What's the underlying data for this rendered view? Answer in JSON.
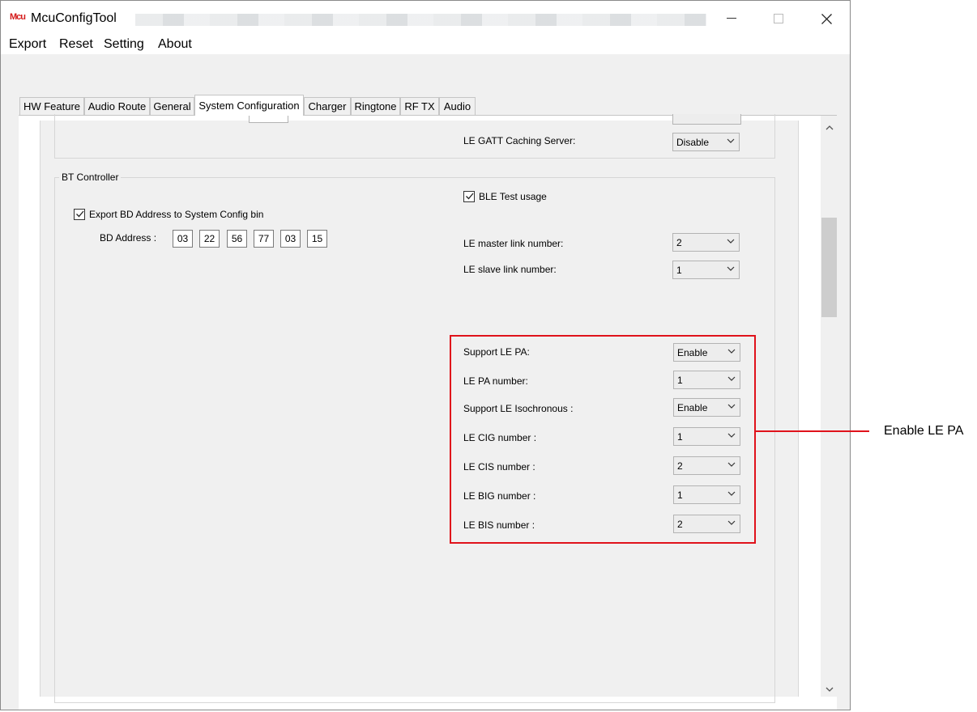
{
  "window": {
    "app_icon_text": "Mcu",
    "title": "McuConfigTool",
    "controls": {
      "minimize": "—",
      "maximize": "☐",
      "close": "✕"
    }
  },
  "menu": [
    "Export",
    "Reset",
    "Setting",
    "About"
  ],
  "tabs": [
    {
      "label": "HW Feature",
      "active": false
    },
    {
      "label": "Audio Route",
      "active": false
    },
    {
      "label": "General",
      "active": false
    },
    {
      "label": "System Configuration",
      "active": true
    },
    {
      "label": "Charger",
      "active": false
    },
    {
      "label": "Ringtone",
      "active": false
    },
    {
      "label": "RF TX",
      "active": false
    },
    {
      "label": "Audio",
      "active": false
    }
  ],
  "prev_group": {
    "le_gatt_caching_server": {
      "label": "LE GATT Caching Server:",
      "value": "Disable"
    }
  },
  "bt_controller": {
    "title": "BT Controller",
    "export_bd": {
      "label": "Export BD Address to System Config bin",
      "checked": true
    },
    "bd_address_label": "BD Address :",
    "bd_address": [
      "03",
      "22",
      "56",
      "77",
      "03",
      "15"
    ],
    "ble_test": {
      "label": "BLE Test usage",
      "checked": true
    },
    "le_master": {
      "label": "LE master link number:",
      "value": "2"
    },
    "le_slave": {
      "label": "LE slave link number:",
      "value": "1"
    },
    "le_pa_settings": [
      {
        "label": "Support LE PA:",
        "value": "Enable"
      },
      {
        "label": "LE PA number:",
        "value": "1"
      },
      {
        "label": "Support LE Isochronous :",
        "value": "Enable"
      },
      {
        "label": "LE CIG number :",
        "value": "1"
      },
      {
        "label": "LE CIS number :",
        "value": "2"
      },
      {
        "label": "LE BIG number :",
        "value": "1"
      },
      {
        "label": "LE BIS number :",
        "value": "2"
      }
    ]
  },
  "scroll": {
    "up": "⌃",
    "down": "⌄"
  },
  "annotation": {
    "text": "Enable LE PA",
    "color": "#e0121b"
  }
}
